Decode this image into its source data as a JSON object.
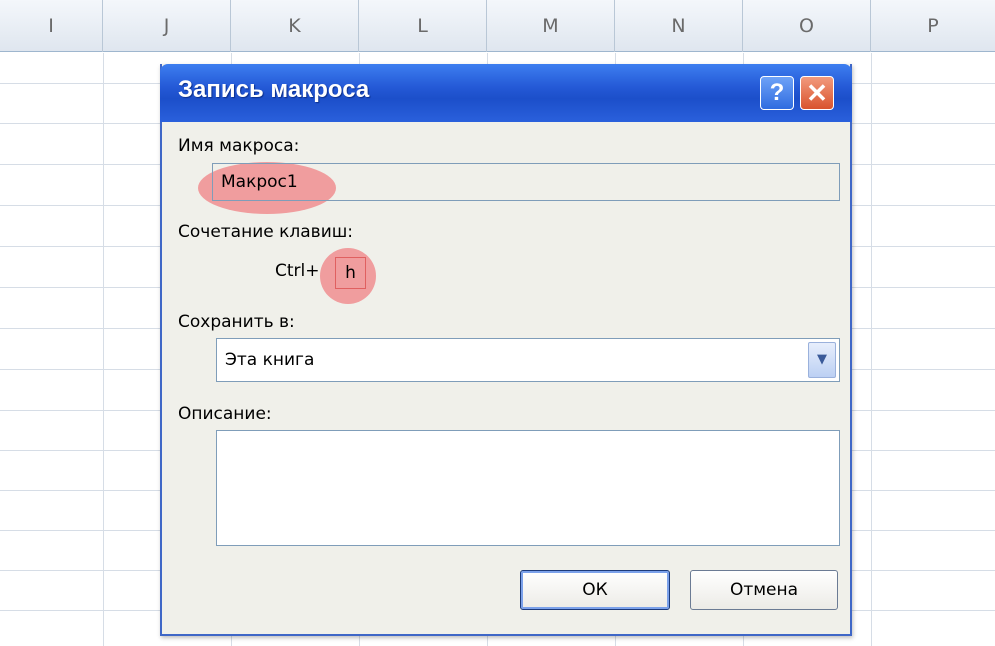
{
  "sheet": {
    "columns": [
      "I",
      "J",
      "K",
      "L",
      "M",
      "N",
      "O",
      "P"
    ]
  },
  "dialog": {
    "title": "Запись макроса",
    "help_label": "?",
    "close_label": "✕",
    "macro_name": {
      "label": "Имя макроса:",
      "value": "Макрос1"
    },
    "shortcut": {
      "label": "Сочетание клавиш:",
      "prefix": "Ctrl+",
      "value": "h"
    },
    "store_in": {
      "label": "Сохранить в:",
      "value": "Эта книга"
    },
    "description": {
      "label": "Описание:",
      "value": ""
    },
    "ok_label": "ОК",
    "cancel_label": "Отмена"
  },
  "colors": {
    "titlebar": "#2459d6",
    "highlight": "#f05a5f",
    "dialog_bg": "#f0f0ea"
  }
}
